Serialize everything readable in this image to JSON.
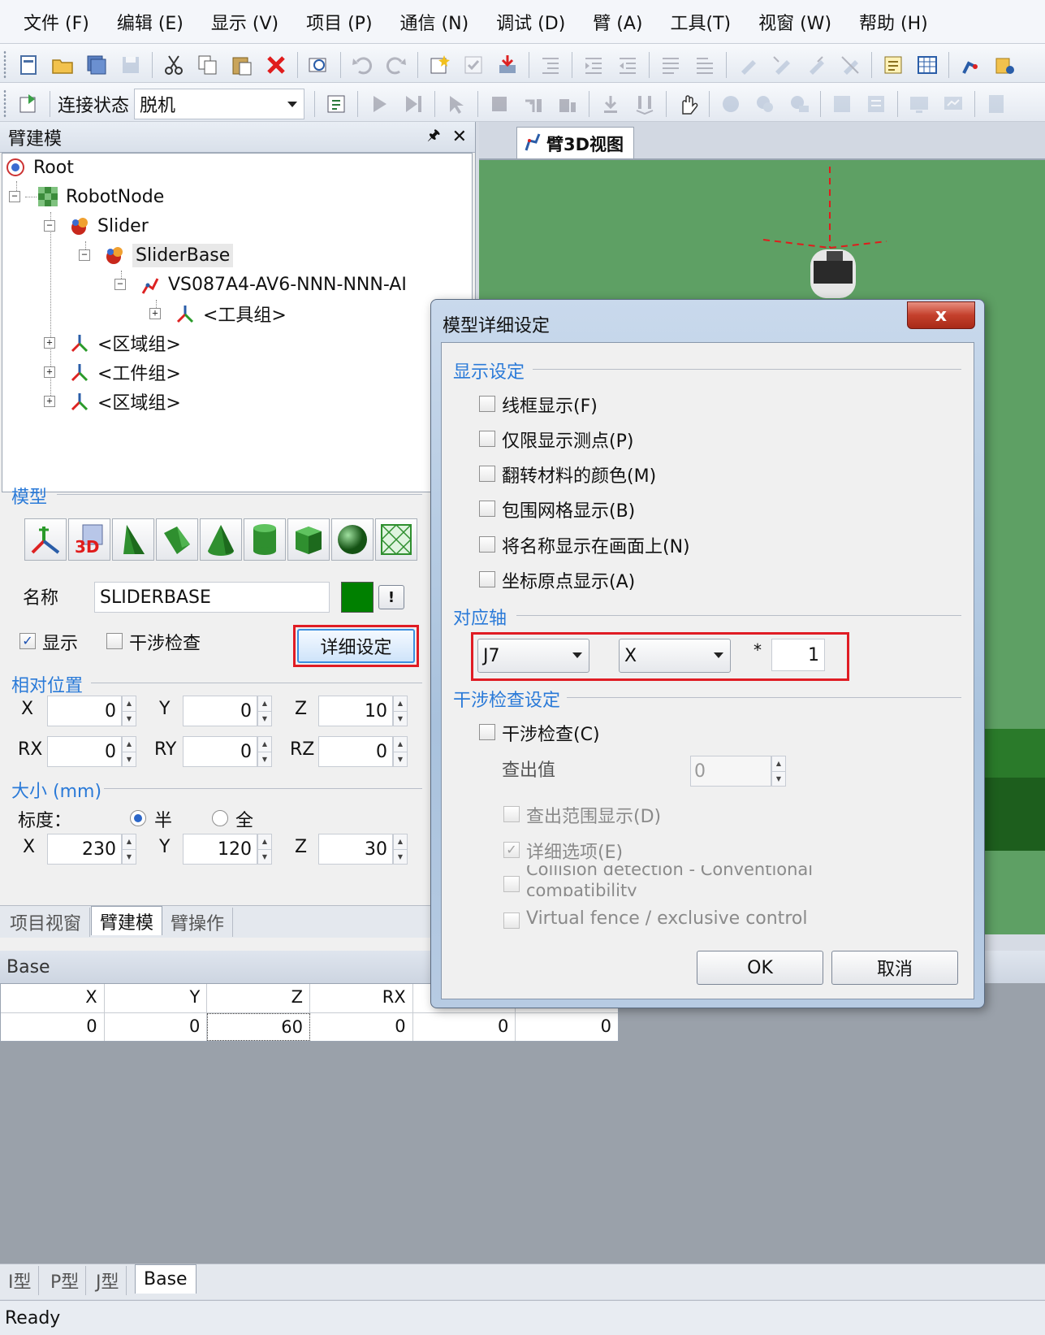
{
  "menu": [
    "文件 (F)",
    "编辑 (E)",
    "显示 (V)",
    "项目 (P)",
    "通信 (N)",
    "调试 (D)",
    "臂 (A)",
    "工具(T)",
    "视窗 (W)",
    "帮助 (H)"
  ],
  "toolbar2": {
    "connection_label": "连接状态",
    "connection_value": "脱机"
  },
  "left_panel": {
    "title": "臂建模",
    "tree": {
      "root": "Root",
      "robot_node": "RobotNode",
      "slider": "Slider",
      "slider_base": "SliderBase",
      "robot_model": "VS087A4-AV6-NNN-NNN-AI",
      "tool_group": "<工具组>",
      "area_group_1": "<区域组>",
      "work_group": "<工件组>",
      "area_group_2": "<区域组>"
    },
    "model": {
      "section_title": "模型",
      "name_label": "名称",
      "name_value": "SLIDERBASE",
      "color": "#008000",
      "warn_label": "!",
      "display_label": "显示",
      "display_checked": true,
      "interference_label": "干涉检查",
      "interference_checked": false,
      "detail_button": "详细设定"
    },
    "relative_position": {
      "section_title": "相对位置",
      "x_label": "X",
      "x": "0",
      "y_label": "Y",
      "y": "0",
      "z_label": "Z",
      "z": "10",
      "rx_label": "RX",
      "rx": "0",
      "ry_label": "RY",
      "ry": "0",
      "rz_label": "RZ",
      "rz": "0"
    },
    "size": {
      "section_title": "大小 (mm)",
      "scale_label": "标度：",
      "half_label": "半",
      "full_label": "全",
      "x_label": "X",
      "x": "230",
      "y_label": "Y",
      "y": "120",
      "z_label": "Z",
      "z": "30"
    },
    "tabs": [
      "项目视窗",
      "臂建模",
      "臂操作"
    ],
    "active_tab": 1
  },
  "view3d": {
    "tab_label": "臂3D视图"
  },
  "grid": {
    "title": "Base",
    "headers": [
      "X",
      "Y",
      "Z",
      "RX",
      "",
      ""
    ],
    "row": [
      "0",
      "0",
      "60",
      "0",
      "0",
      "0"
    ]
  },
  "bottom_tabs": [
    "I型",
    "P型",
    "J型",
    "Base"
  ],
  "status": "Ready",
  "dialog": {
    "title": "模型详细设定",
    "close_label": "x",
    "display_section": "显示设定",
    "display_options": [
      "线框显示(F)",
      "仅限显示测点(P)",
      "翻转材料的颜色(M)",
      "包围网格显示(B)",
      "将名称显示在画面上(N)",
      "坐标原点显示(A)"
    ],
    "axis_section": "对应轴",
    "axis_joint": "J7",
    "axis_direction": "X",
    "axis_multiplier_sign": "*",
    "axis_factor": "1",
    "interference_section": "干涉检查设定",
    "interference_check": "干涉检查(C)",
    "detect_value_label": "查出值",
    "detect_value": "0",
    "detect_range_display": "查出范围显示(D)",
    "detail_options": "详细选项(E)",
    "collision_line1": "Collision detection - Conventional",
    "collision_line2": "compatibility",
    "virtual_fence": "Virtual fence / exclusive control",
    "ok": "OK",
    "cancel": "取消"
  }
}
